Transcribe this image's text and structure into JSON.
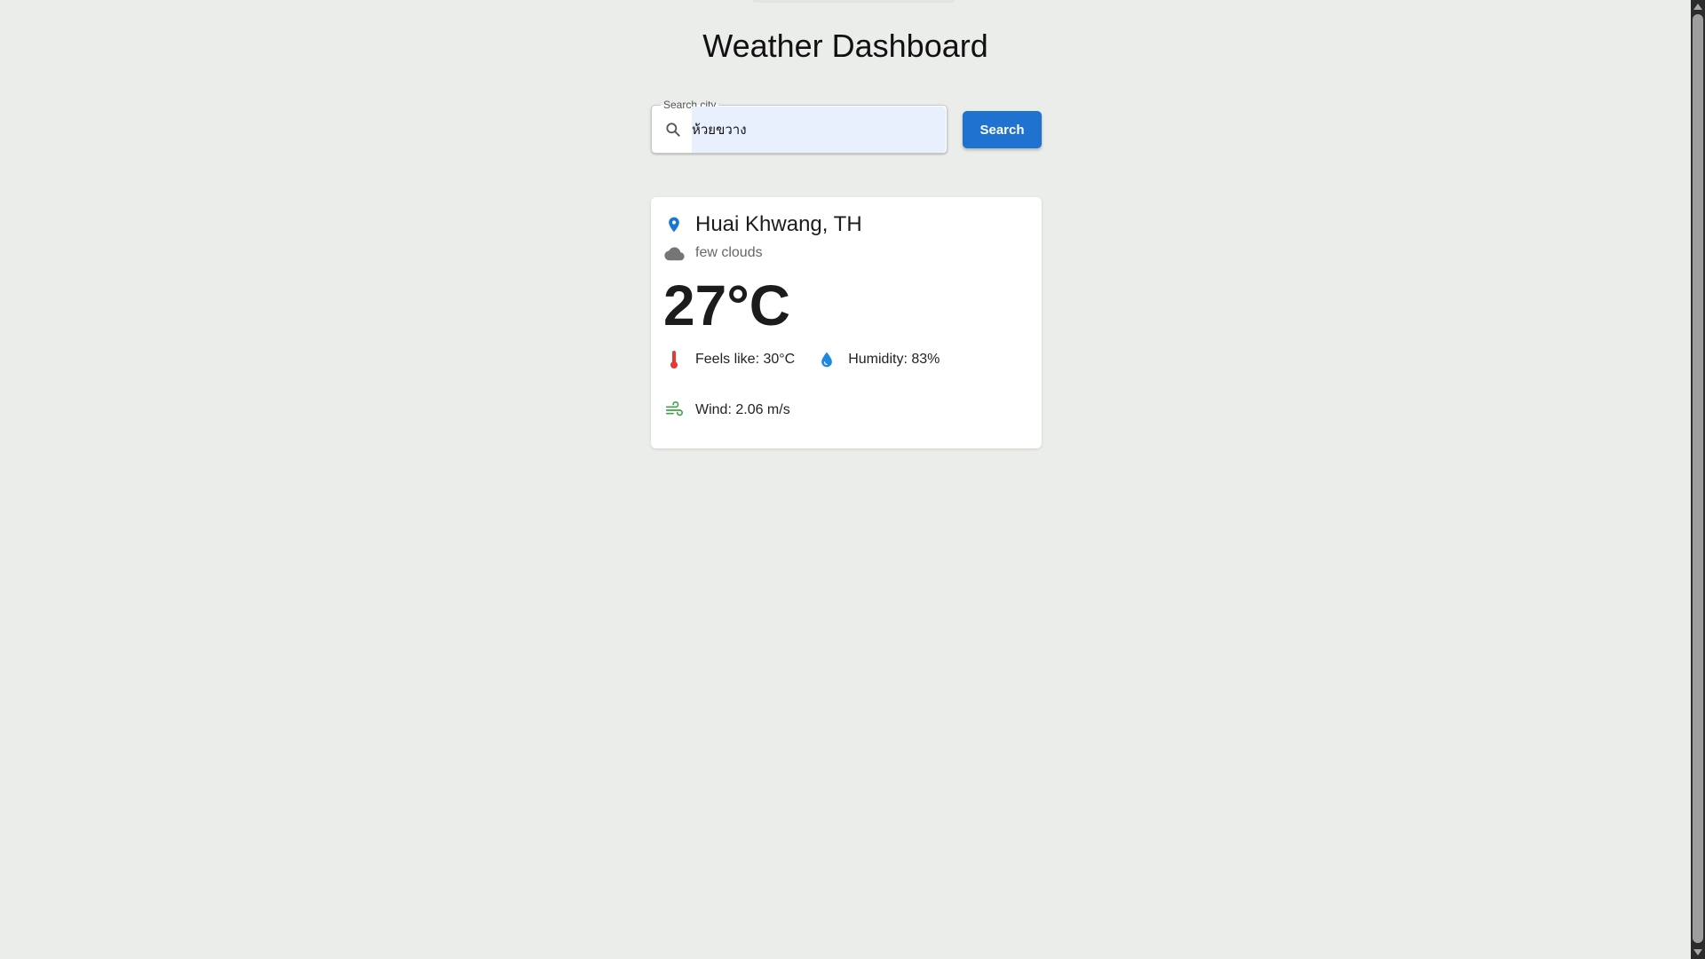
{
  "page": {
    "title": "Weather Dashboard"
  },
  "search": {
    "label": "Search city",
    "value": "ห้วยขวาง",
    "button_label": "Search",
    "icon": "search-icon"
  },
  "weather": {
    "location": "Huai Khwang, TH",
    "condition": "few clouds",
    "temperature": "27°C",
    "feels_like": "Feels like: 30°C",
    "humidity": "Humidity: 83%",
    "wind": "Wind: 2.06 m/s",
    "icons": {
      "location": "location-pin-icon",
      "condition": "cloud-icon",
      "feels_like": "thermometer-icon",
      "humidity": "water-drop-icon",
      "wind": "wind-icon"
    }
  },
  "colors": {
    "background": "#ebedea",
    "accent": "#1f72cf",
    "pin": "#1976d2",
    "thermometer": "#e53935",
    "drop": "#1e88e5",
    "wind": "#43a047",
    "cloud": "#757575"
  }
}
